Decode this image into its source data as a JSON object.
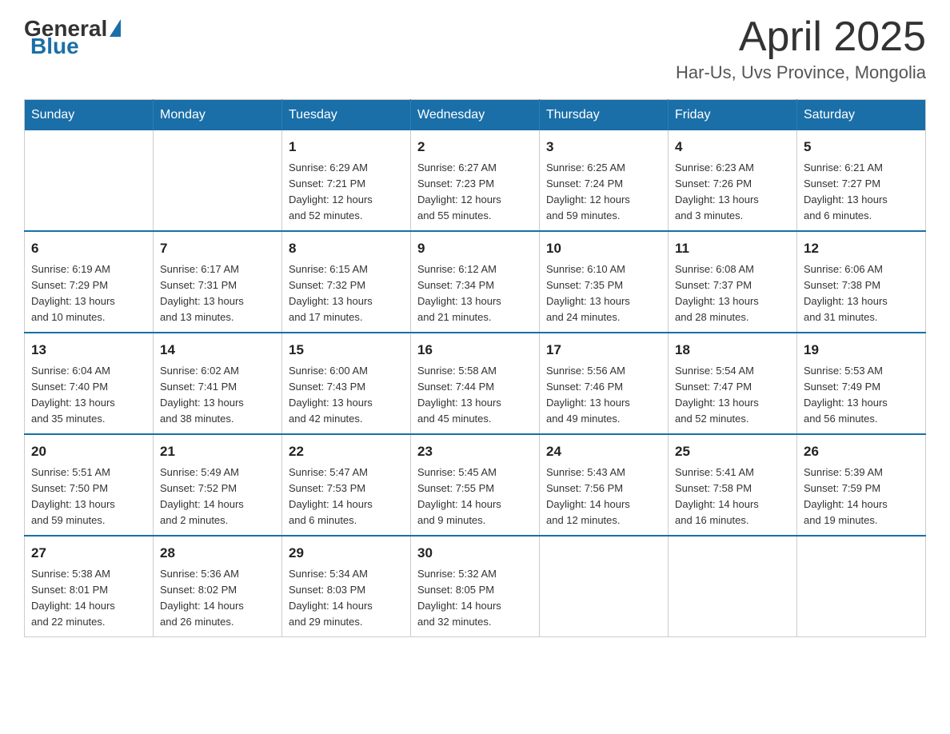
{
  "header": {
    "logo": {
      "general": "General",
      "blue": "Blue"
    },
    "title": "April 2025",
    "location": "Har-Us, Uvs Province, Mongolia"
  },
  "weekdays": [
    "Sunday",
    "Monday",
    "Tuesday",
    "Wednesday",
    "Thursday",
    "Friday",
    "Saturday"
  ],
  "weeks": [
    [
      {
        "day": "",
        "info": ""
      },
      {
        "day": "",
        "info": ""
      },
      {
        "day": "1",
        "info": "Sunrise: 6:29 AM\nSunset: 7:21 PM\nDaylight: 12 hours\nand 52 minutes."
      },
      {
        "day": "2",
        "info": "Sunrise: 6:27 AM\nSunset: 7:23 PM\nDaylight: 12 hours\nand 55 minutes."
      },
      {
        "day": "3",
        "info": "Sunrise: 6:25 AM\nSunset: 7:24 PM\nDaylight: 12 hours\nand 59 minutes."
      },
      {
        "day": "4",
        "info": "Sunrise: 6:23 AM\nSunset: 7:26 PM\nDaylight: 13 hours\nand 3 minutes."
      },
      {
        "day": "5",
        "info": "Sunrise: 6:21 AM\nSunset: 7:27 PM\nDaylight: 13 hours\nand 6 minutes."
      }
    ],
    [
      {
        "day": "6",
        "info": "Sunrise: 6:19 AM\nSunset: 7:29 PM\nDaylight: 13 hours\nand 10 minutes."
      },
      {
        "day": "7",
        "info": "Sunrise: 6:17 AM\nSunset: 7:31 PM\nDaylight: 13 hours\nand 13 minutes."
      },
      {
        "day": "8",
        "info": "Sunrise: 6:15 AM\nSunset: 7:32 PM\nDaylight: 13 hours\nand 17 minutes."
      },
      {
        "day": "9",
        "info": "Sunrise: 6:12 AM\nSunset: 7:34 PM\nDaylight: 13 hours\nand 21 minutes."
      },
      {
        "day": "10",
        "info": "Sunrise: 6:10 AM\nSunset: 7:35 PM\nDaylight: 13 hours\nand 24 minutes."
      },
      {
        "day": "11",
        "info": "Sunrise: 6:08 AM\nSunset: 7:37 PM\nDaylight: 13 hours\nand 28 minutes."
      },
      {
        "day": "12",
        "info": "Sunrise: 6:06 AM\nSunset: 7:38 PM\nDaylight: 13 hours\nand 31 minutes."
      }
    ],
    [
      {
        "day": "13",
        "info": "Sunrise: 6:04 AM\nSunset: 7:40 PM\nDaylight: 13 hours\nand 35 minutes."
      },
      {
        "day": "14",
        "info": "Sunrise: 6:02 AM\nSunset: 7:41 PM\nDaylight: 13 hours\nand 38 minutes."
      },
      {
        "day": "15",
        "info": "Sunrise: 6:00 AM\nSunset: 7:43 PM\nDaylight: 13 hours\nand 42 minutes."
      },
      {
        "day": "16",
        "info": "Sunrise: 5:58 AM\nSunset: 7:44 PM\nDaylight: 13 hours\nand 45 minutes."
      },
      {
        "day": "17",
        "info": "Sunrise: 5:56 AM\nSunset: 7:46 PM\nDaylight: 13 hours\nand 49 minutes."
      },
      {
        "day": "18",
        "info": "Sunrise: 5:54 AM\nSunset: 7:47 PM\nDaylight: 13 hours\nand 52 minutes."
      },
      {
        "day": "19",
        "info": "Sunrise: 5:53 AM\nSunset: 7:49 PM\nDaylight: 13 hours\nand 56 minutes."
      }
    ],
    [
      {
        "day": "20",
        "info": "Sunrise: 5:51 AM\nSunset: 7:50 PM\nDaylight: 13 hours\nand 59 minutes."
      },
      {
        "day": "21",
        "info": "Sunrise: 5:49 AM\nSunset: 7:52 PM\nDaylight: 14 hours\nand 2 minutes."
      },
      {
        "day": "22",
        "info": "Sunrise: 5:47 AM\nSunset: 7:53 PM\nDaylight: 14 hours\nand 6 minutes."
      },
      {
        "day": "23",
        "info": "Sunrise: 5:45 AM\nSunset: 7:55 PM\nDaylight: 14 hours\nand 9 minutes."
      },
      {
        "day": "24",
        "info": "Sunrise: 5:43 AM\nSunset: 7:56 PM\nDaylight: 14 hours\nand 12 minutes."
      },
      {
        "day": "25",
        "info": "Sunrise: 5:41 AM\nSunset: 7:58 PM\nDaylight: 14 hours\nand 16 minutes."
      },
      {
        "day": "26",
        "info": "Sunrise: 5:39 AM\nSunset: 7:59 PM\nDaylight: 14 hours\nand 19 minutes."
      }
    ],
    [
      {
        "day": "27",
        "info": "Sunrise: 5:38 AM\nSunset: 8:01 PM\nDaylight: 14 hours\nand 22 minutes."
      },
      {
        "day": "28",
        "info": "Sunrise: 5:36 AM\nSunset: 8:02 PM\nDaylight: 14 hours\nand 26 minutes."
      },
      {
        "day": "29",
        "info": "Sunrise: 5:34 AM\nSunset: 8:03 PM\nDaylight: 14 hours\nand 29 minutes."
      },
      {
        "day": "30",
        "info": "Sunrise: 5:32 AM\nSunset: 8:05 PM\nDaylight: 14 hours\nand 32 minutes."
      },
      {
        "day": "",
        "info": ""
      },
      {
        "day": "",
        "info": ""
      },
      {
        "day": "",
        "info": ""
      }
    ]
  ]
}
